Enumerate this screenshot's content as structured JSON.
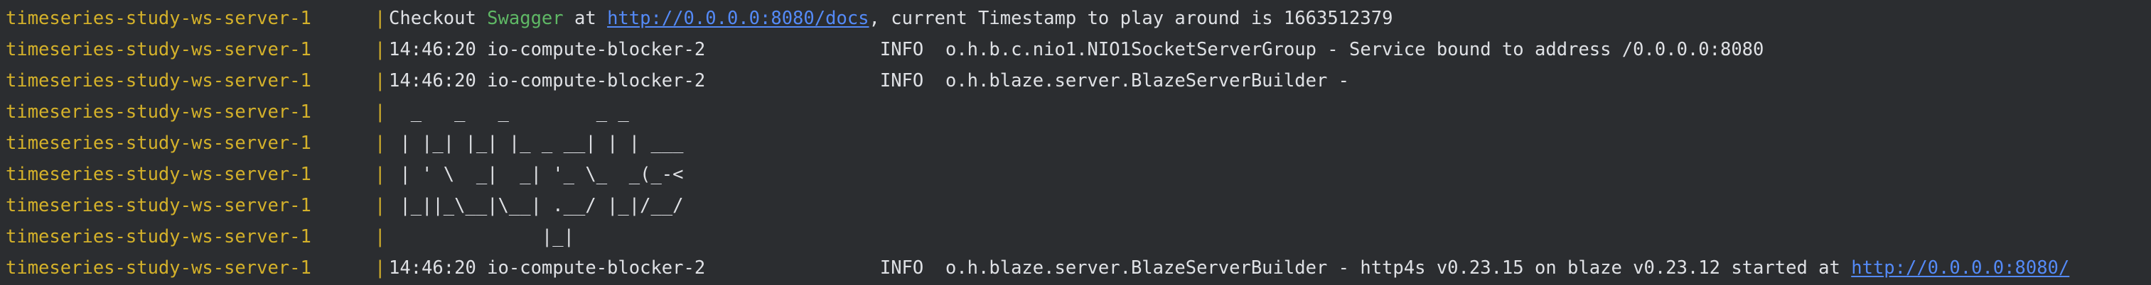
{
  "colors": {
    "background": "#2b2d30",
    "prefix": "#d4b12a",
    "text": "#dfe1e5",
    "swagger": "#5fb865",
    "link": "#548af7"
  },
  "separator": "|",
  "lines": [
    {
      "prefix": "timeseries-study-ws-server-1",
      "segments": [
        {
          "text": "Checkout ",
          "style": "plain"
        },
        {
          "text": "Swagger",
          "style": "green"
        },
        {
          "text": " at ",
          "style": "plain"
        },
        {
          "text": "http://0.0.0.0:8080/docs",
          "style": "link"
        },
        {
          "text": ", current Timestamp to play around is 1663512379",
          "style": "plain"
        }
      ]
    },
    {
      "prefix": "timeseries-study-ws-server-1",
      "segments": [
        {
          "text": "14:46:20 io-compute-blocker-2                INFO  o.h.b.c.nio1.NIO1SocketServerGroup - Service bound to address /0.0.0.0:8080",
          "style": "plain"
        }
      ]
    },
    {
      "prefix": "timeseries-study-ws-server-1",
      "segments": [
        {
          "text": "14:46:20 io-compute-blocker-2                INFO  o.h.blaze.server.BlazeServerBuilder -",
          "style": "plain"
        }
      ]
    },
    {
      "prefix": "timeseries-study-ws-server-1",
      "segments": [
        {
          "text": "  _   _   _        _ _",
          "style": "plain"
        }
      ]
    },
    {
      "prefix": "timeseries-study-ws-server-1",
      "segments": [
        {
          "text": " | |_| |_| |_ _ __| | | ___",
          "style": "plain"
        }
      ]
    },
    {
      "prefix": "timeseries-study-ws-server-1",
      "segments": [
        {
          "text": " | ' \\  _|  _| '_ \\_  _(_-<",
          "style": "plain"
        }
      ]
    },
    {
      "prefix": "timeseries-study-ws-server-1",
      "segments": [
        {
          "text": " |_||_\\__|\\__| .__/ |_|/__/",
          "style": "plain"
        }
      ]
    },
    {
      "prefix": "timeseries-study-ws-server-1",
      "segments": [
        {
          "text": "              |_|",
          "style": "plain"
        }
      ]
    },
    {
      "prefix": "timeseries-study-ws-server-1",
      "segments": [
        {
          "text": "14:46:20 io-compute-blocker-2                INFO  o.h.blaze.server.BlazeServerBuilder - http4s v0.23.15 on blaze v0.23.12 started at ",
          "style": "plain"
        },
        {
          "text": "http://0.0.0.0:8080/",
          "style": "link"
        }
      ]
    }
  ]
}
